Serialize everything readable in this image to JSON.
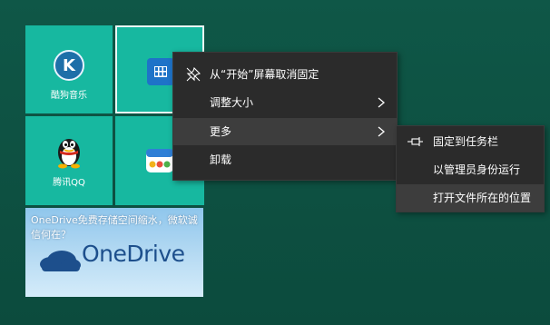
{
  "tiles": {
    "kugou": {
      "label": "酷狗音乐",
      "icon": "kugou-music-icon"
    },
    "store": {
      "icon": "store-icon"
    },
    "qq": {
      "label": "腾讯QQ",
      "icon": "qq-penguin-icon"
    },
    "app": {
      "icon": "app-icon"
    },
    "onedrive": {
      "headline": "OneDrive免费存储空间缩水，微软诚信何在？",
      "brand": "OneDrive",
      "icon": "onedrive-cloud-icon"
    }
  },
  "context_menu": {
    "items": [
      {
        "label": "从“开始”屏幕取消固定",
        "icon": "unpin-icon",
        "submenu": false
      },
      {
        "label": "调整大小",
        "submenu": true
      },
      {
        "label": "更多",
        "submenu": true,
        "hover": true
      },
      {
        "label": "卸载",
        "submenu": false
      }
    ]
  },
  "submenu": {
    "items": [
      {
        "label": "固定到任务栏",
        "icon": "pin-to-taskbar-icon"
      },
      {
        "label": "以管理员身份运行"
      },
      {
        "label": "打开文件所在的位置",
        "hover": true
      }
    ]
  },
  "colors": {
    "background": "#0f5747",
    "tile": "#17b8a0",
    "menu": "#2b2b2b",
    "menu_hover": "#3d3d3d"
  }
}
